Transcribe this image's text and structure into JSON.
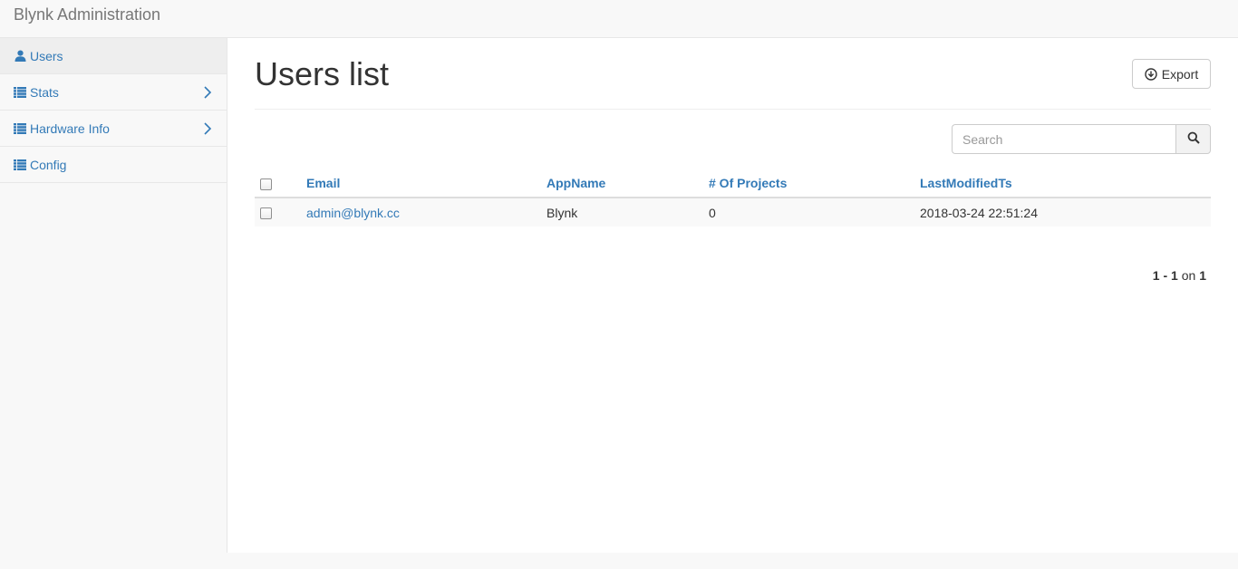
{
  "app": {
    "title": "Blynk Administration"
  },
  "sidebar": {
    "items": [
      {
        "label": "Users",
        "icon": "user-icon",
        "active": true
      },
      {
        "label": "Stats",
        "icon": "list-icon",
        "expandable": true
      },
      {
        "label": "Hardware Info",
        "icon": "list-icon",
        "expandable": true
      },
      {
        "label": "Config",
        "icon": "list-icon"
      }
    ]
  },
  "main": {
    "title": "Users list",
    "export_label": "Export",
    "search": {
      "placeholder": "Search",
      "value": ""
    },
    "table": {
      "columns": [
        "Email",
        "AppName",
        "# Of Projects",
        "LastModifiedTs"
      ],
      "rows": [
        {
          "email": "admin@blynk.cc",
          "app_name": "Blynk",
          "projects": "0",
          "last_modified": "2018-03-24 22:51:24"
        }
      ]
    },
    "pagination": {
      "start": "1",
      "sep": "-",
      "end": "1",
      "on": "on",
      "total": "1"
    }
  },
  "colors": {
    "link": "#337ab7",
    "sidebar_bg": "#f8f8f8",
    "active_item_bg": "#eeeeee",
    "border": "#e7e7e7",
    "row_stripe": "#f9f9f9"
  }
}
